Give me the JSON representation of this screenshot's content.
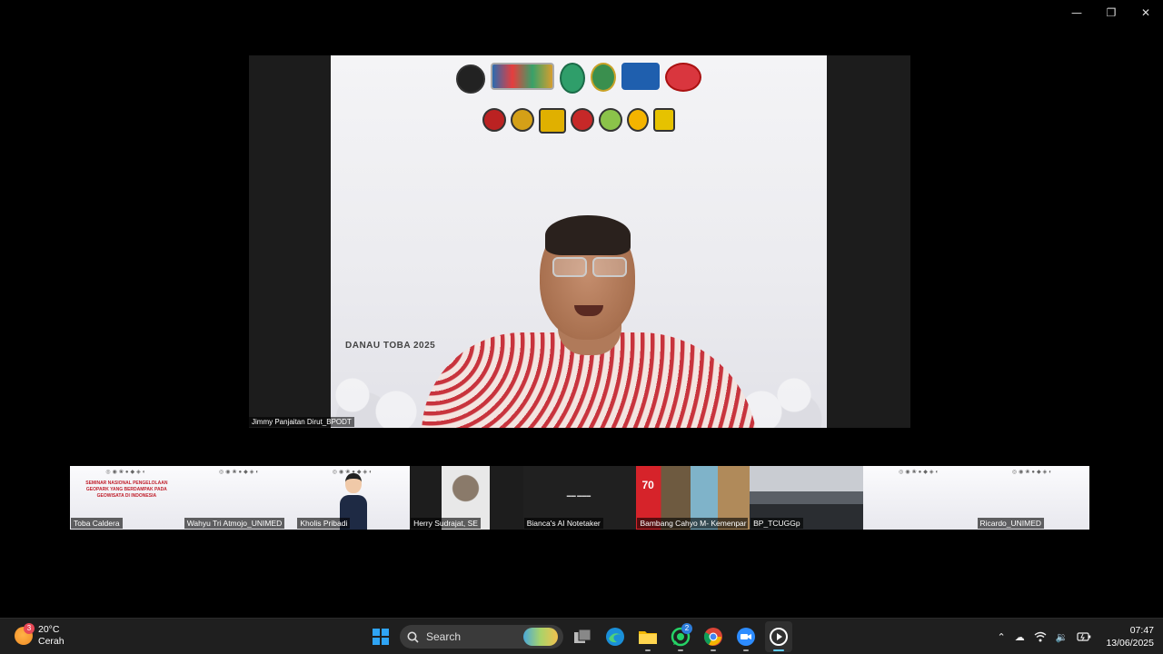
{
  "window": {
    "minimize": "—",
    "restore": "❐",
    "close": "✕"
  },
  "main_speaker": {
    "name": "Jimmy Panjaitan Dirut_BPODT",
    "banner_text": "DANAU TOBA 2025"
  },
  "gallery": [
    {
      "name": "Toba Caldera"
    },
    {
      "name": "Wahyu Tri Atmojo_UNIMED"
    },
    {
      "name": "Kholis Pribadi"
    },
    {
      "name": "Herry Sudrajat, SE"
    },
    {
      "name": "Bianca's AI Notetaker"
    },
    {
      "name": "Bambang Cahyo M- Kemenpar"
    },
    {
      "name": "BP_TCUGGp"
    },
    {
      "name": ""
    },
    {
      "name": "Ricardo_UNIMED"
    }
  ],
  "slide_mini": {
    "title": "SEMINAR NASIONAL PENGELOLAAN GEOPARK YANG BERDAMPAK PADA GEOWISATA DI INDONESIA",
    "logos": "◎◉❀●◆◈◐"
  },
  "collage_badge": "70",
  "taskbar": {
    "weather": {
      "badge": "3",
      "temp": "20°C",
      "desc": "Cerah"
    },
    "search": {
      "label": "Search"
    },
    "whatsapp_badge": "2",
    "clock": {
      "time": "07:47",
      "date": "13/06/2025"
    }
  },
  "colors": {
    "accent": "#60cdff",
    "taskbar": "#1f1f1f",
    "windows_blue": "#2fa4f5"
  }
}
